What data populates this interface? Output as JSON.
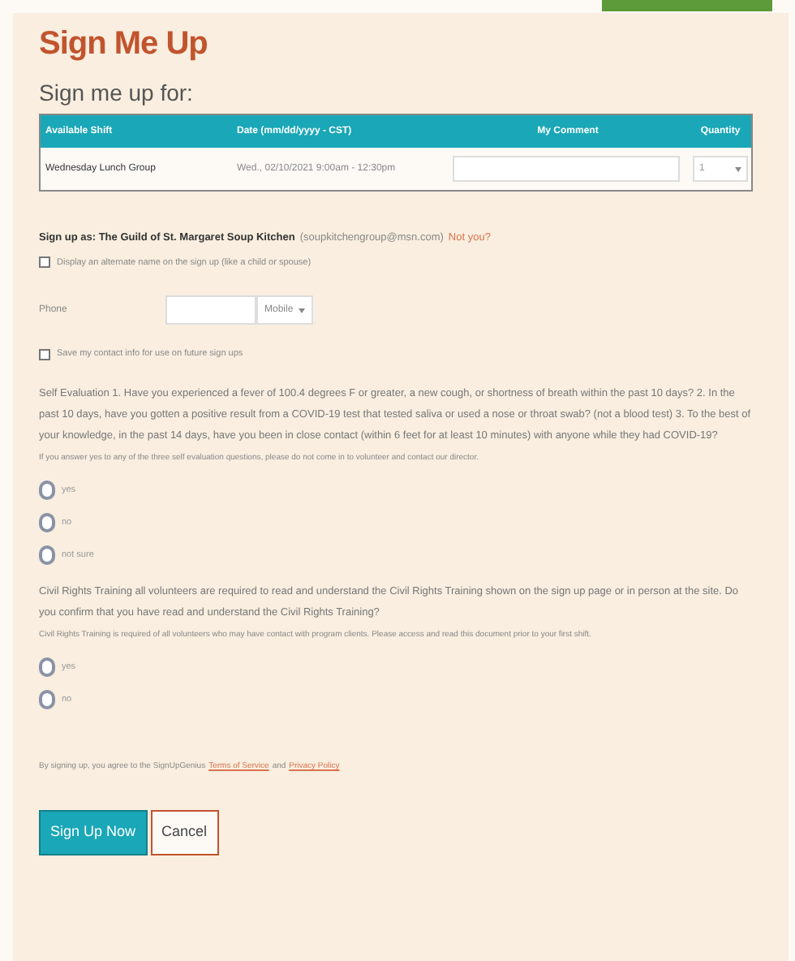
{
  "title": "Sign Me Up",
  "subtitle": "Sign me up for:",
  "table": {
    "columns": [
      "Available Shift",
      "Date (mm/dd/yyyy - CST)",
      "My Comment",
      "Quantity"
    ],
    "rows": [
      {
        "shift": "Wednesday Lunch Group",
        "date": "Wed., 02/10/2021 9:00am - 12:30pm",
        "quantity": "1"
      }
    ]
  },
  "sign_up_as": {
    "label": "Sign up as: The Guild of St. Margaret Soup Kitchen",
    "email": "(soupkitchengroup@msn.com)",
    "link": "Not you?"
  },
  "alternate_name": {
    "label": "Display an alternate name on the sign up (like a child or spouse)",
    "checked": false
  },
  "phone": {
    "label": "Phone",
    "type": "Mobile"
  },
  "save_contact": {
    "label": "Save my contact info for use on future sign ups",
    "checked": false
  },
  "questions": [
    {
      "text": "Self Evaluation 1. Have you experienced a fever of 100.4 degrees F or greater, a new cough, or shortness of breath within the past 10 days? 2. In the past 10 days, have you gotten a positive result from a COVID-19 test that tested saliva or used a nose or throat swab? (not a blood test) 3. To the best of your knowledge, in the past 14 days, have you been in close contact (within 6 feet for at least 10 minutes) with anyone while they had COVID-19?",
      "note": "If you answer yes to any of the three self evaluation questions, please do not come in to volunteer and contact our director.",
      "options": [
        {
          "label": "yes",
          "selected": false
        },
        {
          "label": "no",
          "selected": false
        },
        {
          "label": "not sure",
          "selected": false
        }
      ]
    },
    {
      "text": "Civil Rights Training all volunteers are required to read and understand the Civil Rights Training shown on the sign up page or in person at the site. Do you confirm that you have read and understand the Civil Rights Training?",
      "note": "Civil Rights Training is required of all volunteers who may have contact with program clients. Please access and read this document prior to your first shift.",
      "options": [
        {
          "label": "yes",
          "selected": false
        },
        {
          "label": "no",
          "selected": false
        }
      ]
    }
  ],
  "terms": {
    "prefix": "By signing up, you agree to the SignUpGenius",
    "link1": "Terms of Service",
    "middle": "and",
    "link2": "Privacy Policy"
  },
  "buttons": [
    {
      "label": "Sign Up Now",
      "kind": "primary"
    },
    {
      "label": "Cancel",
      "kind": "secondary"
    }
  ]
}
